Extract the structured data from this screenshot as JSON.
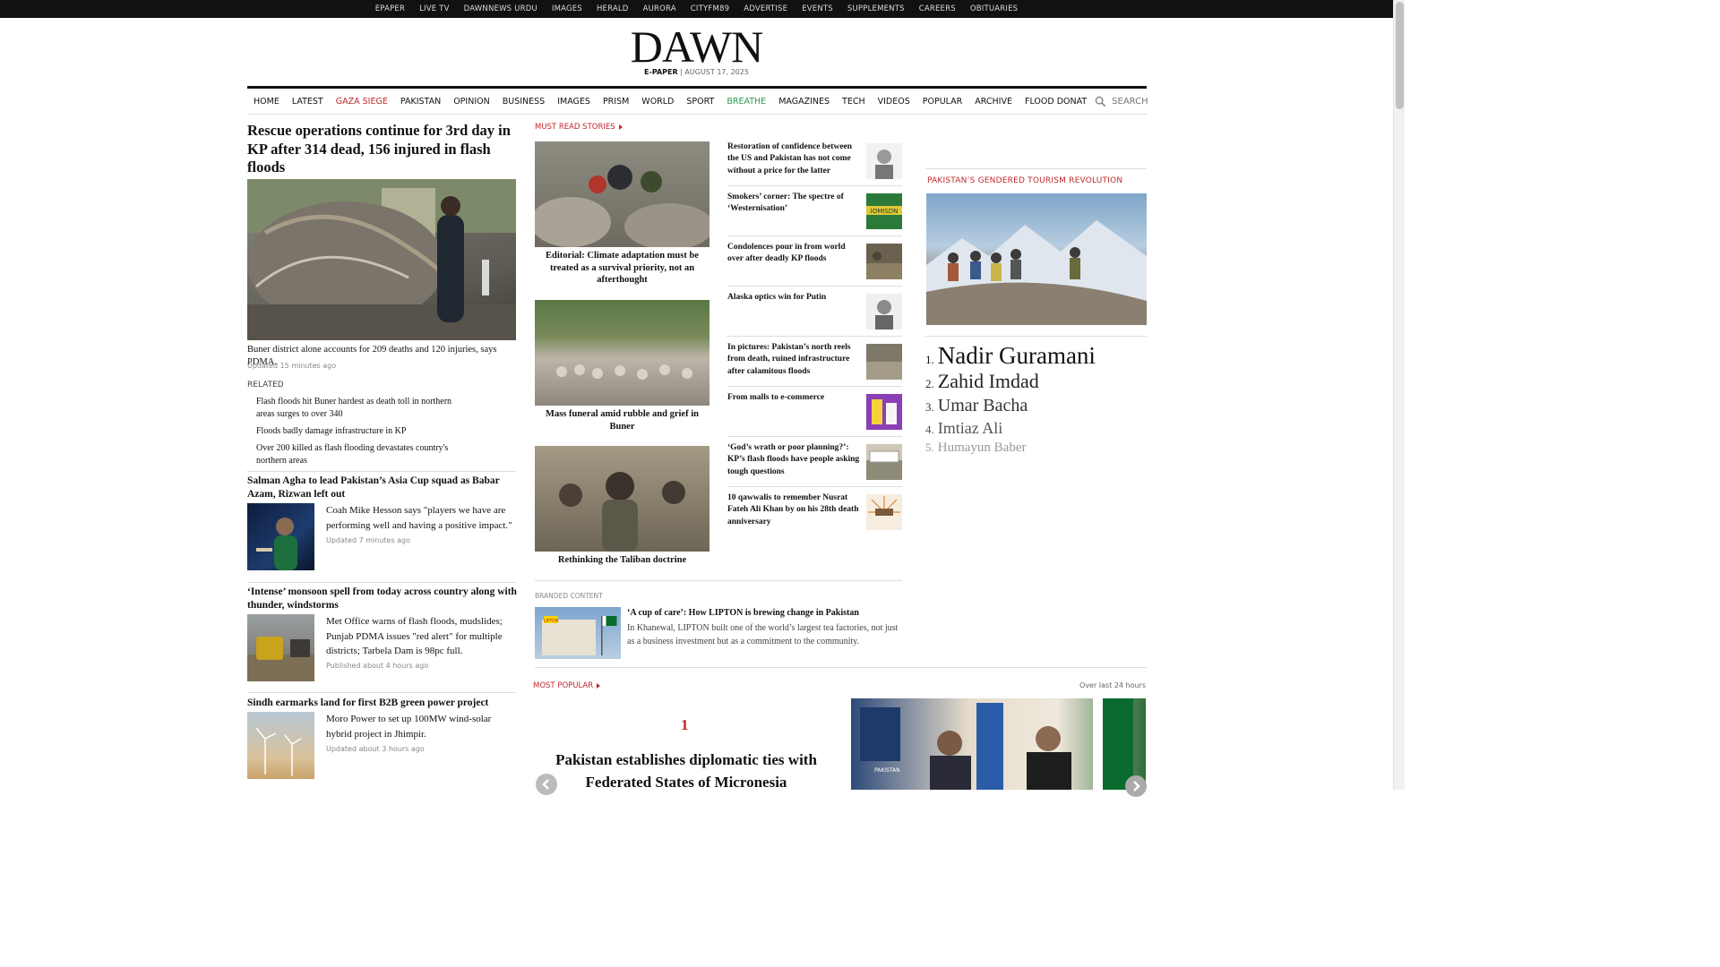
{
  "topbar": [
    "EPAPER",
    "LIVE TV",
    "DAWNNEWS URDU",
    "IMAGES",
    "HERALD",
    "AURORA",
    "CITYFM89",
    "ADVERTISE",
    "EVENTS",
    "SUPPLEMENTS",
    "CAREERS",
    "OBITUARIES"
  ],
  "masthead": {
    "logo": "DAWN",
    "epaper": "E-PAPER",
    "date": "AUGUST 17, 2025"
  },
  "nav": {
    "items": [
      "HOME",
      "LATEST",
      "GAZA SIEGE",
      "PAKISTAN",
      "OPINION",
      "BUSINESS",
      "IMAGES",
      "PRISM",
      "WORLD",
      "SPORT",
      "BREATHE",
      "MAGAZINES",
      "TECH",
      "VIDEOS",
      "POPULAR",
      "ARCHIVE",
      "FLOOD DONAT"
    ],
    "search_placeholder": "SEARCH"
  },
  "lead": {
    "title": "Rescue operations continue for 3rd day in KP after 314 dead, 156 injured in flash floods",
    "caption": "Buner district alone accounts for 209 deaths and 120 injuries, says PDMA.",
    "updated": "Updated 15 minutes ago",
    "related_heading": "RELATED",
    "related": [
      "Flash floods hit Buner hardest as death toll in northern areas surges to over 340",
      "Floods badly damage infrastructure in KP",
      "Over 200 killed as flash flooding devastates country's northern areas"
    ]
  },
  "stories": [
    {
      "title": "Salman Agha to lead Pakistan’s Asia Cup squad as Babar Azam, Rizwan left out",
      "excerpt": "Coah Mike Hesson says \"players we have are performing well and having a positive impact.\"",
      "time": "Updated 7 minutes ago"
    },
    {
      "title": "‘Intense’ monsoon spell from today across country along with thunder, windstorms",
      "excerpt": "Met Office warns of flash floods, mudslides; Punjab PDMA issues \"red alert\" for multiple districts; Tarbela Dam is 98pc full.",
      "time": "Published about 4 hours ago"
    },
    {
      "title": "Sindh earmarks land for first B2B green power project",
      "excerpt": "Moro Power to set up 100MW wind-solar hybrid project in Jhimpir.",
      "time": "Updated about 3 hours ago"
    }
  ],
  "must_read": {
    "heading": "MUST READ STORIES",
    "main": [
      "Editorial: Climate adaptation must be treated as a survival priority, not an afterthought",
      "Mass funeral amid rubble and grief in Buner",
      "Rethinking the Taliban doctrine"
    ],
    "side": [
      "Restoration of confidence between the US and Pakistan has not come without a price for the latter",
      "Smokers’ corner: The spectre of ‘Westernisation’",
      "Condolences pour in from world over after deadly KP floods",
      "Alaska optics win for Putin",
      "In pictures: Pakistan’s north reels from death, ruined infrastructure after calamitous floods",
      "From malls to e-commerce",
      "‘God’s wrath or poor planning?’: KP’s flash floods have people asking tough questions",
      "10 qawwalis to remember Nusrat Fateh Ali Khan by on his 28th death anniversary"
    ],
    "thumb2_text": "IOMISDN"
  },
  "branded": {
    "heading": "BRANDED CONTENT",
    "title": "‘A cup of care’: How LIPTON is brewing change in Pakistan",
    "excerpt": "In Khanewal, LIPTON built one of the world’s largest tea factories, not just as a business investment but as a commitment to the community.",
    "sign": "LIPTON"
  },
  "right": {
    "heading": "PAKISTAN’S GENDERED TOURISM REVOLUTION",
    "ranked": [
      {
        "n": "1.",
        "name": "Nadir Guramani"
      },
      {
        "n": "2.",
        "name": "Zahid Imdad"
      },
      {
        "n": "3.",
        "name": "Umar Bacha"
      },
      {
        "n": "4.",
        "name": "Imtiaz Ali"
      },
      {
        "n": "5.",
        "name": "Humayun Baber"
      }
    ]
  },
  "most_popular": {
    "heading": "MOST POPULAR",
    "sub": "Over last 24 hours",
    "number": "1",
    "title": "Pakistan establishes diplomatic ties with Federated States of Micronesia",
    "badge": "PAKISTAN"
  }
}
